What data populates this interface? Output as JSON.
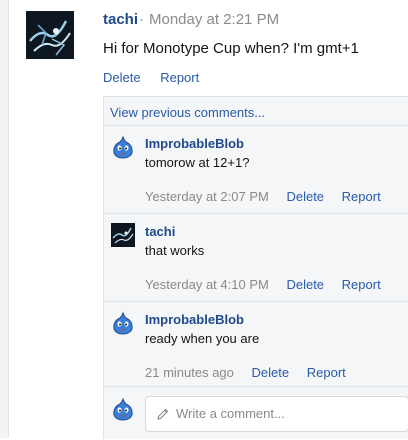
{
  "post": {
    "author": "tachi",
    "separator": "·",
    "time": "Monday at 2:21 PM",
    "text": "Hi for Monotype Cup when? I'm gmt+1",
    "actions": {
      "delete": "Delete",
      "report": "Report"
    }
  },
  "comments": {
    "view_previous": "View previous comments...",
    "items": [
      {
        "author": "ImprobableBlob",
        "text": "tomorow at 12+1?",
        "time": "Yesterday at 2:07 PM",
        "delete": "Delete",
        "report": "Report",
        "avatar": "blue-slime-icon"
      },
      {
        "author": "tachi",
        "text": "that works",
        "time": "Yesterday at 4:10 PM",
        "delete": "Delete",
        "report": "Report",
        "avatar": "dark-artwork-avatar"
      },
      {
        "author": "ImprobableBlob",
        "text": "ready when you are",
        "time": "21 minutes ago",
        "delete": "Delete",
        "report": "Report",
        "avatar": "blue-slime-icon"
      }
    ]
  },
  "reply": {
    "placeholder": "Write a comment...",
    "icon": "pencil-icon"
  },
  "colors": {
    "link": "#2a5aa8",
    "author": "#1e4a8a",
    "muted": "#8a8a8a",
    "panel": "#f5f6f8"
  }
}
